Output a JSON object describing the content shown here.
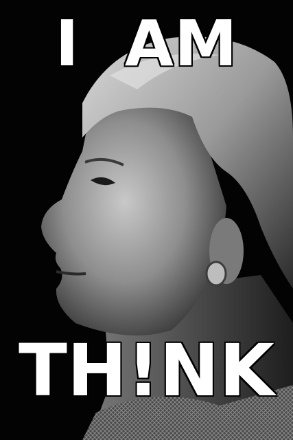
{
  "top_caption": "I  AM",
  "bottom_caption": "TH!NK"
}
